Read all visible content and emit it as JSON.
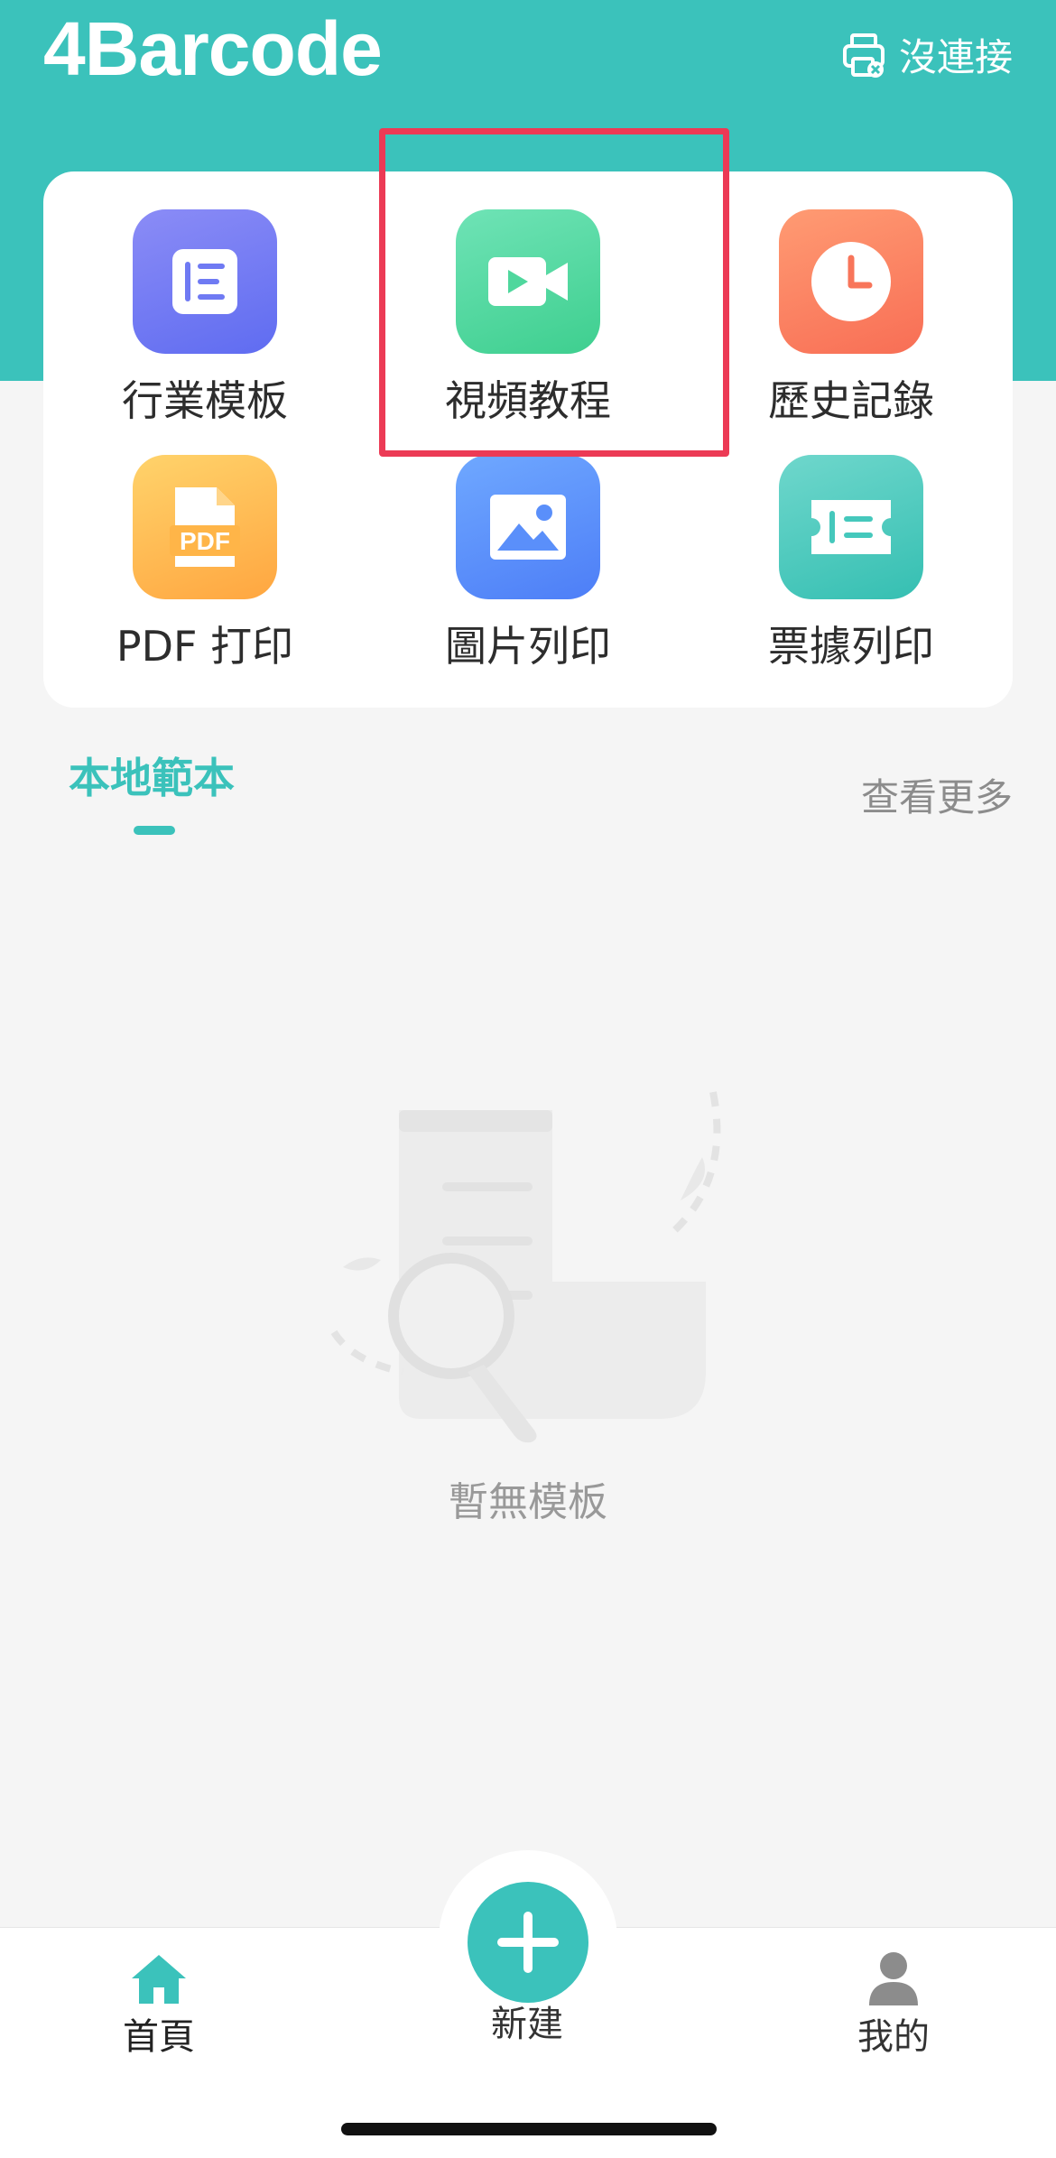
{
  "header": {
    "app_title": "4Barcode",
    "connection_status": "沒連接",
    "printer_icon": "printer-disconnected-icon"
  },
  "features": [
    {
      "label": "行業模板",
      "icon": "template-list-icon",
      "color": "#6f7af3"
    },
    {
      "label": "視頻教程",
      "icon": "video-camera-icon",
      "color": "#4fd79d"
    },
    {
      "label": "歷史記錄",
      "icon": "clock-icon",
      "color": "#fb805f"
    },
    {
      "label": "PDF 打印",
      "icon": "pdf-file-icon",
      "color": "#ffbb50"
    },
    {
      "label": "圖片列印",
      "icon": "image-icon",
      "color": "#5a8ffa"
    },
    {
      "label": "票據列印",
      "icon": "receipt-icon",
      "color": "#45c8bc"
    }
  ],
  "highlight_color": "#ec3a55",
  "section": {
    "title": "本地範本",
    "view_more": "查看更多"
  },
  "empty_state": {
    "text": "暫無模板",
    "icon": "empty-document-search-icon"
  },
  "tabbar": {
    "home": {
      "label": "首頁",
      "icon": "home-icon"
    },
    "new": {
      "label": "新建",
      "icon": "plus-icon"
    },
    "mine": {
      "label": "我的",
      "icon": "user-icon"
    }
  },
  "accent_color": "#3bc2bb"
}
